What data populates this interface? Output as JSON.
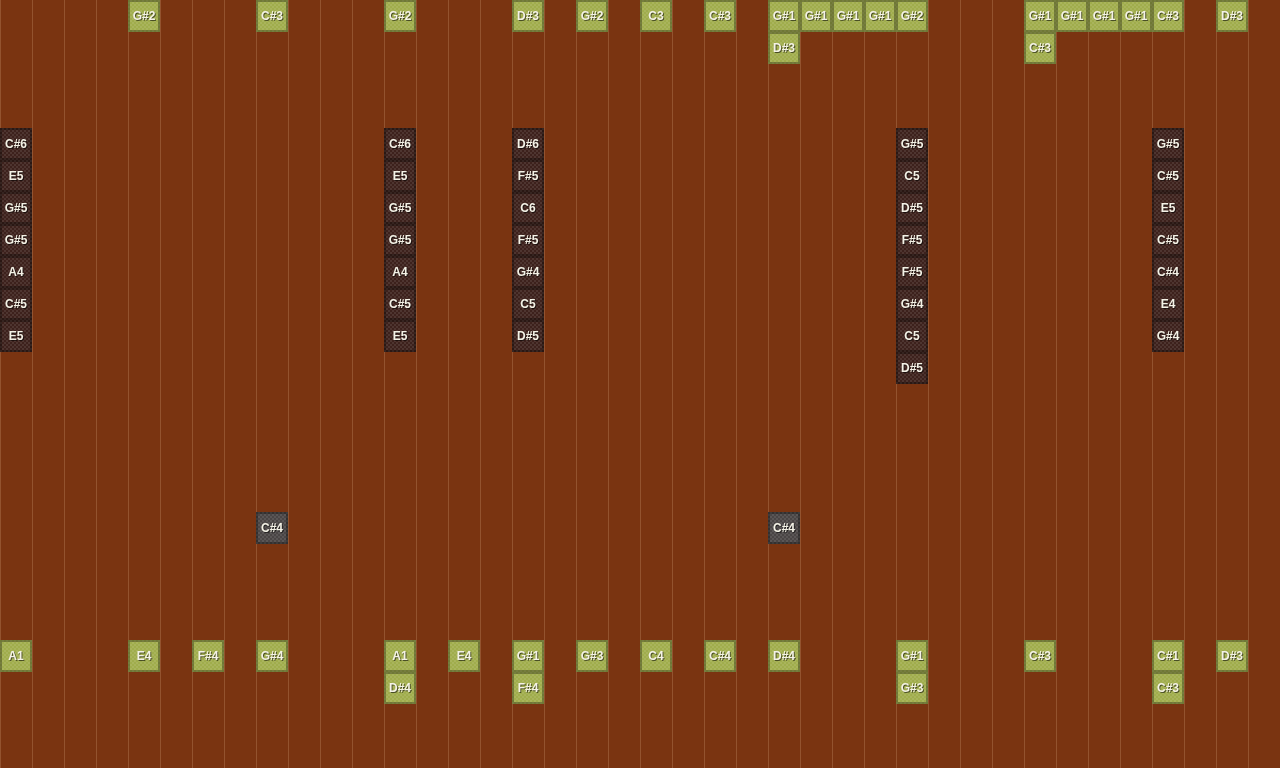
{
  "ticks": [
    {
      "kind": "column",
      "cells": [
        {
          "kind": "rest"
        },
        {
          "kind": "rest"
        },
        {
          "kind": "rest"
        },
        {
          "kind": "rest"
        },
        {
          "kind": "note",
          "label": "C#6",
          "color": "#3d211c"
        },
        {
          "kind": "note",
          "label": "E5",
          "color": "#3d211c"
        },
        {
          "kind": "note",
          "label": "G#5",
          "color": "#3d211c"
        },
        {
          "kind": "note",
          "label": "G#5",
          "color": "#3d211c"
        },
        {
          "kind": "note",
          "label": "A4",
          "color": "#3d211c"
        },
        {
          "kind": "note",
          "label": "C#5",
          "color": "#3d211c"
        },
        {
          "kind": "note",
          "label": "E5",
          "color": "#3d211c"
        },
        {
          "kind": "rest"
        },
        {
          "kind": "rest"
        },
        {
          "kind": "rest"
        },
        {
          "kind": "rest"
        },
        {
          "kind": "rest"
        },
        {
          "kind": "rest"
        },
        {
          "kind": "rest"
        },
        {
          "kind": "rest"
        },
        {
          "kind": "rest"
        },
        {
          "kind": "note",
          "label": "A1",
          "color": "#a0ad4c"
        }
      ]
    },
    {
      "kind": "empty"
    },
    {
      "kind": "empty"
    },
    {
      "kind": "empty"
    },
    {
      "kind": "column",
      "cells": [
        {
          "kind": "note",
          "label": "G#2",
          "color": "#a0ad4c"
        },
        {
          "kind": "rest"
        },
        {
          "kind": "rest"
        },
        {
          "kind": "rest"
        },
        {
          "kind": "rest"
        },
        {
          "kind": "rest"
        },
        {
          "kind": "rest"
        },
        {
          "kind": "rest"
        },
        {
          "kind": "rest"
        },
        {
          "kind": "rest"
        },
        {
          "kind": "rest"
        },
        {
          "kind": "rest"
        },
        {
          "kind": "rest"
        },
        {
          "kind": "rest"
        },
        {
          "kind": "rest"
        },
        {
          "kind": "rest"
        },
        {
          "kind": "rest"
        },
        {
          "kind": "rest"
        },
        {
          "kind": "rest"
        },
        {
          "kind": "rest"
        },
        {
          "kind": "note",
          "label": "E4",
          "color": "#a0ad4c"
        }
      ]
    },
    {
      "kind": "empty"
    },
    {
      "kind": "column",
      "cells": [
        {
          "kind": "rest"
        },
        {
          "kind": "rest"
        },
        {
          "kind": "rest"
        },
        {
          "kind": "rest"
        },
        {
          "kind": "rest"
        },
        {
          "kind": "rest"
        },
        {
          "kind": "rest"
        },
        {
          "kind": "rest"
        },
        {
          "kind": "rest"
        },
        {
          "kind": "rest"
        },
        {
          "kind": "rest"
        },
        {
          "kind": "rest"
        },
        {
          "kind": "rest"
        },
        {
          "kind": "rest"
        },
        {
          "kind": "rest"
        },
        {
          "kind": "rest"
        },
        {
          "kind": "rest"
        },
        {
          "kind": "rest"
        },
        {
          "kind": "rest"
        },
        {
          "kind": "rest"
        },
        {
          "kind": "note",
          "label": "F#4",
          "color": "#a0ad4c"
        }
      ]
    },
    {
      "kind": "empty"
    },
    {
      "kind": "column",
      "cells": [
        {
          "kind": "note",
          "label": "C#3",
          "color": "#a0ad4c"
        },
        {
          "kind": "rest"
        },
        {
          "kind": "rest"
        },
        {
          "kind": "rest"
        },
        {
          "kind": "rest"
        },
        {
          "kind": "rest"
        },
        {
          "kind": "rest"
        },
        {
          "kind": "rest"
        },
        {
          "kind": "rest"
        },
        {
          "kind": "rest"
        },
        {
          "kind": "rest"
        },
        {
          "kind": "rest"
        },
        {
          "kind": "rest"
        },
        {
          "kind": "rest"
        },
        {
          "kind": "rest"
        },
        {
          "kind": "rest"
        },
        {
          "kind": "note",
          "label": "C#4",
          "color": "#4a4545"
        },
        {
          "kind": "rest"
        },
        {
          "kind": "rest"
        },
        {
          "kind": "rest"
        },
        {
          "kind": "note",
          "label": "G#4",
          "color": "#a0ad4c"
        }
      ]
    },
    {
      "kind": "empty"
    },
    {
      "kind": "empty"
    },
    {
      "kind": "empty"
    },
    {
      "kind": "column",
      "cells": [
        {
          "kind": "note",
          "label": "G#2",
          "color": "#a0ad4c"
        },
        {
          "kind": "rest"
        },
        {
          "kind": "rest"
        },
        {
          "kind": "rest"
        },
        {
          "kind": "note",
          "label": "C#6",
          "color": "#3d211c"
        },
        {
          "kind": "note",
          "label": "E5",
          "color": "#3d211c"
        },
        {
          "kind": "note",
          "label": "G#5",
          "color": "#3d211c"
        },
        {
          "kind": "note",
          "label": "G#5",
          "color": "#3d211c"
        },
        {
          "kind": "note",
          "label": "A4",
          "color": "#3d211c"
        },
        {
          "kind": "note",
          "label": "C#5",
          "color": "#3d211c"
        },
        {
          "kind": "note",
          "label": "E5",
          "color": "#3d211c"
        },
        {
          "kind": "rest"
        },
        {
          "kind": "rest"
        },
        {
          "kind": "rest"
        },
        {
          "kind": "rest"
        },
        {
          "kind": "rest"
        },
        {
          "kind": "rest"
        },
        {
          "kind": "rest"
        },
        {
          "kind": "rest"
        },
        {
          "kind": "rest"
        },
        {
          "kind": "note",
          "label": "A1",
          "color": "#a0ad4c"
        },
        {
          "kind": "note",
          "label": "D#4",
          "color": "#a0ad4c"
        }
      ]
    },
    {
      "kind": "empty"
    },
    {
      "kind": "column",
      "cells": [
        {
          "kind": "rest"
        },
        {
          "kind": "rest"
        },
        {
          "kind": "rest"
        },
        {
          "kind": "rest"
        },
        {
          "kind": "rest"
        },
        {
          "kind": "rest"
        },
        {
          "kind": "rest"
        },
        {
          "kind": "rest"
        },
        {
          "kind": "rest"
        },
        {
          "kind": "rest"
        },
        {
          "kind": "rest"
        },
        {
          "kind": "rest"
        },
        {
          "kind": "rest"
        },
        {
          "kind": "rest"
        },
        {
          "kind": "rest"
        },
        {
          "kind": "rest"
        },
        {
          "kind": "rest"
        },
        {
          "kind": "rest"
        },
        {
          "kind": "rest"
        },
        {
          "kind": "rest"
        },
        {
          "kind": "note",
          "label": "E4",
          "color": "#a0ad4c"
        }
      ]
    },
    {
      "kind": "empty"
    },
    {
      "kind": "column",
      "cells": [
        {
          "kind": "note",
          "label": "D#3",
          "color": "#a0ad4c"
        },
        {
          "kind": "rest"
        },
        {
          "kind": "rest"
        },
        {
          "kind": "rest"
        },
        {
          "kind": "note",
          "label": "D#6",
          "color": "#3d211c"
        },
        {
          "kind": "note",
          "label": "F#5",
          "color": "#3d211c"
        },
        {
          "kind": "note",
          "label": "C6",
          "color": "#3d211c"
        },
        {
          "kind": "note",
          "label": "F#5",
          "color": "#3d211c"
        },
        {
          "kind": "note",
          "label": "G#4",
          "color": "#3d211c"
        },
        {
          "kind": "note",
          "label": "C5",
          "color": "#3d211c"
        },
        {
          "kind": "note",
          "label": "D#5",
          "color": "#3d211c"
        },
        {
          "kind": "rest"
        },
        {
          "kind": "rest"
        },
        {
          "kind": "rest"
        },
        {
          "kind": "rest"
        },
        {
          "kind": "rest"
        },
        {
          "kind": "rest"
        },
        {
          "kind": "rest"
        },
        {
          "kind": "rest"
        },
        {
          "kind": "rest"
        },
        {
          "kind": "note",
          "label": "G#1",
          "color": "#a0ad4c"
        },
        {
          "kind": "note",
          "label": "F#4",
          "color": "#a0ad4c"
        }
      ]
    },
    {
      "kind": "empty"
    },
    {
      "kind": "column",
      "cells": [
        {
          "kind": "note",
          "label": "G#2",
          "color": "#a0ad4c"
        },
        {
          "kind": "rest"
        },
        {
          "kind": "rest"
        },
        {
          "kind": "rest"
        },
        {
          "kind": "rest"
        },
        {
          "kind": "rest"
        },
        {
          "kind": "rest"
        },
        {
          "kind": "rest"
        },
        {
          "kind": "rest"
        },
        {
          "kind": "rest"
        },
        {
          "kind": "rest"
        },
        {
          "kind": "rest"
        },
        {
          "kind": "rest"
        },
        {
          "kind": "rest"
        },
        {
          "kind": "rest"
        },
        {
          "kind": "rest"
        },
        {
          "kind": "rest"
        },
        {
          "kind": "rest"
        },
        {
          "kind": "rest"
        },
        {
          "kind": "rest"
        },
        {
          "kind": "note",
          "label": "G#3",
          "color": "#a0ad4c"
        }
      ]
    },
    {
      "kind": "empty"
    },
    {
      "kind": "column",
      "cells": [
        {
          "kind": "note",
          "label": "C3",
          "color": "#a0ad4c"
        },
        {
          "kind": "rest"
        },
        {
          "kind": "rest"
        },
        {
          "kind": "rest"
        },
        {
          "kind": "rest"
        },
        {
          "kind": "rest"
        },
        {
          "kind": "rest"
        },
        {
          "kind": "rest"
        },
        {
          "kind": "rest"
        },
        {
          "kind": "rest"
        },
        {
          "kind": "rest"
        },
        {
          "kind": "rest"
        },
        {
          "kind": "rest"
        },
        {
          "kind": "rest"
        },
        {
          "kind": "rest"
        },
        {
          "kind": "rest"
        },
        {
          "kind": "rest"
        },
        {
          "kind": "rest"
        },
        {
          "kind": "rest"
        },
        {
          "kind": "rest"
        },
        {
          "kind": "note",
          "label": "C4",
          "color": "#a0ad4c"
        }
      ]
    },
    {
      "kind": "empty"
    },
    {
      "kind": "column",
      "cells": [
        {
          "kind": "note",
          "label": "C#3",
          "color": "#a0ad4c"
        },
        {
          "kind": "rest"
        },
        {
          "kind": "rest"
        },
        {
          "kind": "rest"
        },
        {
          "kind": "rest"
        },
        {
          "kind": "rest"
        },
        {
          "kind": "rest"
        },
        {
          "kind": "rest"
        },
        {
          "kind": "rest"
        },
        {
          "kind": "rest"
        },
        {
          "kind": "rest"
        },
        {
          "kind": "rest"
        },
        {
          "kind": "rest"
        },
        {
          "kind": "rest"
        },
        {
          "kind": "rest"
        },
        {
          "kind": "rest"
        },
        {
          "kind": "rest"
        },
        {
          "kind": "rest"
        },
        {
          "kind": "rest"
        },
        {
          "kind": "rest"
        },
        {
          "kind": "note",
          "label": "C#4",
          "color": "#a0ad4c"
        }
      ]
    },
    {
      "kind": "empty"
    },
    {
      "kind": "column",
      "cells": [
        {
          "kind": "note",
          "label": "G#1",
          "color": "#a0ad4c"
        },
        {
          "kind": "note",
          "label": "D#3",
          "color": "#a0ad4c"
        },
        {
          "kind": "rest"
        },
        {
          "kind": "rest"
        },
        {
          "kind": "rest"
        },
        {
          "kind": "rest"
        },
        {
          "kind": "rest"
        },
        {
          "kind": "rest"
        },
        {
          "kind": "rest"
        },
        {
          "kind": "rest"
        },
        {
          "kind": "rest"
        },
        {
          "kind": "rest"
        },
        {
          "kind": "rest"
        },
        {
          "kind": "rest"
        },
        {
          "kind": "rest"
        },
        {
          "kind": "rest"
        },
        {
          "kind": "note",
          "label": "C#4",
          "color": "#4a4545"
        },
        {
          "kind": "rest"
        },
        {
          "kind": "rest"
        },
        {
          "kind": "rest"
        },
        {
          "kind": "note",
          "label": "D#4",
          "color": "#a0ad4c"
        }
      ]
    },
    {
      "kind": "column",
      "cells": [
        {
          "kind": "note",
          "label": "G#1",
          "color": "#a0ad4c"
        }
      ]
    },
    {
      "kind": "column",
      "cells": [
        {
          "kind": "note",
          "label": "G#1",
          "color": "#a0ad4c"
        }
      ]
    },
    {
      "kind": "column",
      "cells": [
        {
          "kind": "note",
          "label": "G#1",
          "color": "#a0ad4c"
        }
      ]
    },
    {
      "kind": "column",
      "cells": [
        {
          "kind": "note",
          "label": "G#2",
          "color": "#a0ad4c"
        },
        {
          "kind": "rest"
        },
        {
          "kind": "rest"
        },
        {
          "kind": "rest"
        },
        {
          "kind": "note",
          "label": "G#5",
          "color": "#3d211c"
        },
        {
          "kind": "note",
          "label": "C5",
          "color": "#3d211c"
        },
        {
          "kind": "note",
          "label": "D#5",
          "color": "#3d211c"
        },
        {
          "kind": "note",
          "label": "F#5",
          "color": "#3d211c"
        },
        {
          "kind": "note",
          "label": "F#5",
          "color": "#3d211c"
        },
        {
          "kind": "note",
          "label": "G#4",
          "color": "#3d211c"
        },
        {
          "kind": "note",
          "label": "C5",
          "color": "#3d211c"
        },
        {
          "kind": "note",
          "label": "D#5",
          "color": "#3d211c"
        },
        {
          "kind": "rest"
        },
        {
          "kind": "rest"
        },
        {
          "kind": "rest"
        },
        {
          "kind": "rest"
        },
        {
          "kind": "rest"
        },
        {
          "kind": "rest"
        },
        {
          "kind": "rest"
        },
        {
          "kind": "rest"
        },
        {
          "kind": "note",
          "label": "G#1",
          "color": "#a0ad4c"
        },
        {
          "kind": "note",
          "label": "G#3",
          "color": "#a0ad4c"
        }
      ]
    },
    {
      "kind": "empty"
    },
    {
      "kind": "empty"
    },
    {
      "kind": "empty"
    },
    {
      "kind": "column",
      "cells": [
        {
          "kind": "note",
          "label": "G#1",
          "color": "#a0ad4c"
        },
        {
          "kind": "note",
          "label": "C#3",
          "color": "#a0ad4c"
        },
        {
          "kind": "rest"
        },
        {
          "kind": "rest"
        },
        {
          "kind": "rest"
        },
        {
          "kind": "rest"
        },
        {
          "kind": "rest"
        },
        {
          "kind": "rest"
        },
        {
          "kind": "rest"
        },
        {
          "kind": "rest"
        },
        {
          "kind": "rest"
        },
        {
          "kind": "rest"
        },
        {
          "kind": "rest"
        },
        {
          "kind": "rest"
        },
        {
          "kind": "rest"
        },
        {
          "kind": "rest"
        },
        {
          "kind": "rest"
        },
        {
          "kind": "rest"
        },
        {
          "kind": "rest"
        },
        {
          "kind": "rest"
        },
        {
          "kind": "note",
          "label": "C#3",
          "color": "#a0ad4c"
        }
      ]
    },
    {
      "kind": "column",
      "cells": [
        {
          "kind": "note",
          "label": "G#1",
          "color": "#a0ad4c"
        }
      ]
    },
    {
      "kind": "column",
      "cells": [
        {
          "kind": "note",
          "label": "G#1",
          "color": "#a0ad4c"
        }
      ]
    },
    {
      "kind": "column",
      "cells": [
        {
          "kind": "note",
          "label": "G#1",
          "color": "#a0ad4c"
        }
      ]
    },
    {
      "kind": "column",
      "cells": [
        {
          "kind": "note",
          "label": "C#3",
          "color": "#a0ad4c"
        },
        {
          "kind": "rest"
        },
        {
          "kind": "rest"
        },
        {
          "kind": "rest"
        },
        {
          "kind": "note",
          "label": "G#5",
          "color": "#3d211c"
        },
        {
          "kind": "note",
          "label": "C#5",
          "color": "#3d211c"
        },
        {
          "kind": "note",
          "label": "E5",
          "color": "#3d211c"
        },
        {
          "kind": "note",
          "label": "C#5",
          "color": "#3d211c"
        },
        {
          "kind": "note",
          "label": "C#4",
          "color": "#3d211c"
        },
        {
          "kind": "note",
          "label": "E4",
          "color": "#3d211c"
        },
        {
          "kind": "note",
          "label": "G#4",
          "color": "#3d211c"
        },
        {
          "kind": "rest"
        },
        {
          "kind": "rest"
        },
        {
          "kind": "rest"
        },
        {
          "kind": "rest"
        },
        {
          "kind": "rest"
        },
        {
          "kind": "rest"
        },
        {
          "kind": "rest"
        },
        {
          "kind": "rest"
        },
        {
          "kind": "rest"
        },
        {
          "kind": "note",
          "label": "C#1",
          "color": "#a0ad4c"
        },
        {
          "kind": "note",
          "label": "C#3",
          "color": "#a0ad4c"
        }
      ]
    },
    {
      "kind": "empty"
    },
    {
      "kind": "column",
      "cells": [
        {
          "kind": "note",
          "label": "D#3",
          "color": "#a0ad4c"
        },
        {
          "kind": "rest"
        },
        {
          "kind": "rest"
        },
        {
          "kind": "rest"
        },
        {
          "kind": "rest"
        },
        {
          "kind": "rest"
        },
        {
          "kind": "rest"
        },
        {
          "kind": "rest"
        },
        {
          "kind": "rest"
        },
        {
          "kind": "rest"
        },
        {
          "kind": "rest"
        },
        {
          "kind": "rest"
        },
        {
          "kind": "rest"
        },
        {
          "kind": "rest"
        },
        {
          "kind": "rest"
        },
        {
          "kind": "rest"
        },
        {
          "kind": "rest"
        },
        {
          "kind": "rest"
        },
        {
          "kind": "rest"
        },
        {
          "kind": "rest"
        },
        {
          "kind": "note",
          "label": "D#3",
          "color": "#a0ad4c"
        }
      ]
    },
    {
      "kind": "empty"
    }
  ]
}
